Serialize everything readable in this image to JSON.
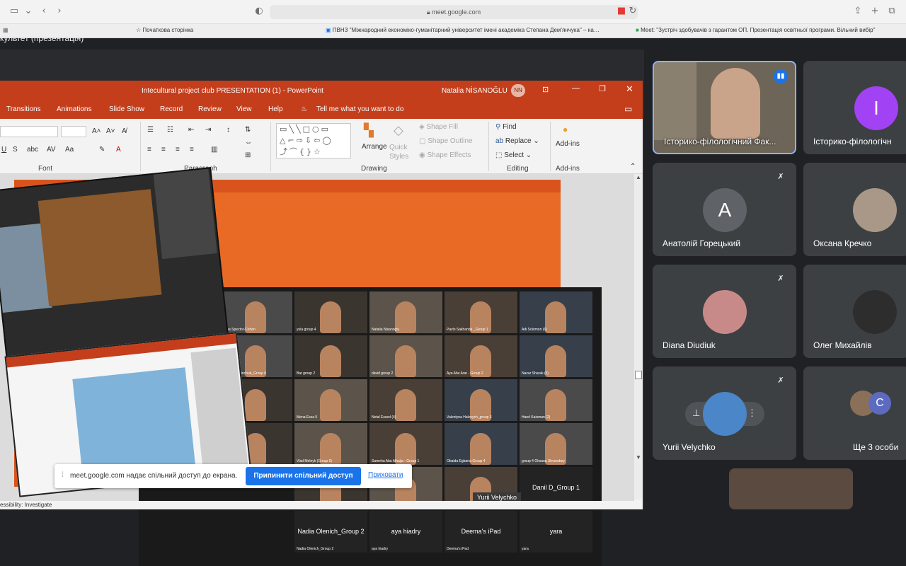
{
  "browser": {
    "url": "meet.google.com",
    "bookmarks": [
      "Початкова сторінка",
      "ПВНЗ \"Міжнародний економіко-гуманітарний університет імені академіка Степана Дем'янчука\" – кал...",
      "Meet: \"Зустріч здобувачів з гарантом ОП. Презентація освітньої програми. Вільний вибір\""
    ]
  },
  "meet": {
    "title_fragment": "культет (презентація)"
  },
  "powerpoint": {
    "title": "Intecultural project club PRESENTATION (1)  -  PowerPoint",
    "user": "Natalia NİSANOĞLU",
    "user_initials": "NN",
    "menu": [
      "Transitions",
      "Animations",
      "Slide Show",
      "Record",
      "Review",
      "View",
      "Help"
    ],
    "tell_me": "Tell me what you want to do",
    "groups": {
      "font": "Font",
      "paragraph": "Paragraph",
      "drawing": "Drawing",
      "editing": "Editing",
      "addins": "Add-ins"
    },
    "buttons": {
      "arrange": "Arrange",
      "quick_styles": "Quick Styles",
      "shape_fill": "Shape Fill",
      "shape_outline": "Shape Outline",
      "shape_effects": "Shape Effects",
      "find": "Find",
      "replace": "Replace",
      "select": "Select",
      "addins": "Add-ins"
    },
    "status": "essibility: Investigate"
  },
  "zoom_tiles": [
    {
      "name": "Elana Spector-Cohen"
    },
    {
      "name": "yula group 4"
    },
    {
      "name": "Natalia Nisanoglu"
    },
    {
      "name": "Pavlo Sakhanda _Group 1"
    },
    {
      "name": "Adi Solomon (6)"
    },
    {
      "name": "Roman Myslinchuk_Group 6"
    },
    {
      "name": "Bar group 2"
    },
    {
      "name": "david group 2"
    },
    {
      "name": "Aya Abu Arar - Group 2"
    },
    {
      "name": "Nazar Sharak (5)"
    },
    {
      "name": "Shaked Ban..."
    },
    {
      "name": "Yazan - (2)"
    },
    {
      "name": "Mena Essa 5"
    },
    {
      "name": "Netal Essed (4)"
    },
    {
      "name": "Valentyna Halovych_group 3"
    },
    {
      "name": "Harel Kaisman (2)"
    },
    {
      "name": "Maria Zrik"
    },
    {
      "name": "Vlad Melnyk (Group 6)"
    },
    {
      "name": "Sameha Abu Alhaija - Group 1"
    },
    {
      "name": "Obaida Egbaria-Group 4"
    },
    {
      "name": "group 4 Oksana Shvorobey"
    },
    {
      "name": "Vadim Kohutyn (6)"
    },
    {
      "name": "Alon Boderiuk- group 5"
    },
    {
      "name": "Alina Hryhorchuk_Group2"
    },
    {
      "name": "Danil D_Group 1"
    },
    {
      "name": "Nadia Olenich_Group 2"
    },
    {
      "name": "aya hiadry"
    },
    {
      "name": "Deema's iPad"
    },
    {
      "name": "yara"
    }
  ],
  "zoom_text_tiles": {
    "danil": "Danil D_Group 1",
    "nadia": "Nadia Olenich_Group 2",
    "aya": "aya hiadry",
    "deema": "Deema's iPad",
    "yara": "yara",
    "tooltip": "Yurii Velychko"
  },
  "share_bar": {
    "message": "meet.google.com надає спільний доступ до екрана.",
    "stop": "Припинити спільний доступ",
    "hide": "Приховати"
  },
  "participants": [
    {
      "name": "Історико-філологічний Фак...",
      "avatar": ""
    },
    {
      "name": "Історико-філологічн",
      "avatar": "I",
      "color": "#a142f4"
    },
    {
      "name": "Анатолій Горецький",
      "avatar": "A",
      "color": "#5f6368"
    },
    {
      "name": "Оксана Кречко",
      "avatar": ""
    },
    {
      "name": "Diana Diudiuk",
      "avatar": ""
    },
    {
      "name": "Олег Михайлів",
      "avatar": ""
    },
    {
      "name": "Yurii Velychko",
      "avatar": ""
    },
    {
      "name": "Ще 3 особи",
      "avatar": "C",
      "color": "#5c6bc0"
    }
  ],
  "colors": {
    "ppt_red": "#c43e1c",
    "meet_bg": "#202124",
    "tile_bg": "#3c4043",
    "accent": "#1a73e8"
  }
}
